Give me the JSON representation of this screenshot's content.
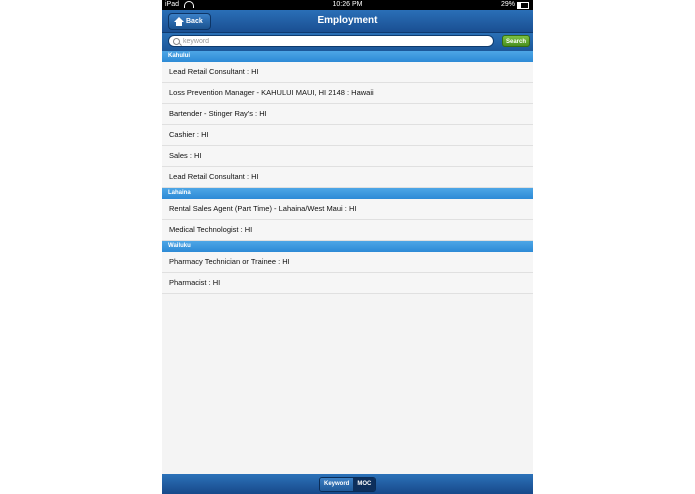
{
  "status_bar": {
    "device": "iPad",
    "time": "10:26 PM",
    "battery": "29%",
    "battery_level": 0.29
  },
  "nav": {
    "back_label": "Back",
    "title": "Employment"
  },
  "search": {
    "placeholder": "keyword",
    "button_label": "Search"
  },
  "sections": [
    {
      "header": "Kahului",
      "items": [
        "Lead Retail Consultant : HI",
        "Loss Prevention Manager - KAHULUI MAUI, HI 2148 : Hawaii",
        "Bartender - Stinger Ray's : HI",
        "Cashier : HI",
        "Sales : HI",
        "Lead Retail Consultant : HI"
      ]
    },
    {
      "header": "Lahaina",
      "items": [
        "Rental Sales Agent (Part Time) - Lahaina/West Maui : HI",
        "Medical Technologist : HI"
      ]
    },
    {
      "header": "Wailuku",
      "items": [
        "Pharmacy Technician or Trainee : HI",
        "Pharmacist : HI"
      ]
    }
  ],
  "tabs": {
    "keyword_label": "Keyword",
    "moc_label": "MOC",
    "active": "Keyword"
  }
}
